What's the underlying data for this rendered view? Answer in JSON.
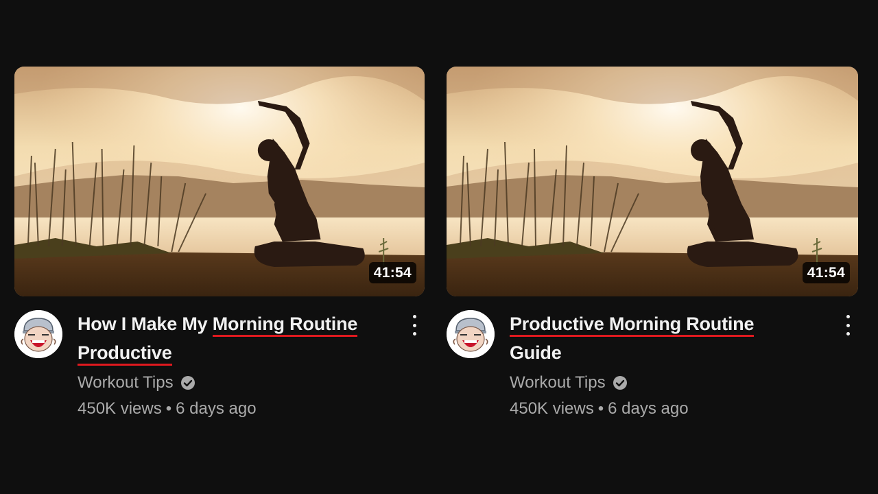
{
  "videos": [
    {
      "title_plain": "How I Make My ",
      "title_highlight_1": "Morning Routine",
      "title_highlight_2": "Productive",
      "title_after": "",
      "duration": "41:54",
      "channel": "Workout Tips",
      "views": "450K views",
      "separator": "•",
      "age": "6 days ago",
      "verified_icon": "check-circle-icon",
      "menu_icon": "more-vertical-icon"
    },
    {
      "title_plain": "",
      "title_highlight_1": "Productive Morning Routine",
      "title_highlight_2": "",
      "title_after": "Guide",
      "duration": "41:54",
      "channel": "Workout Tips",
      "views": "450K views",
      "separator": "•",
      "age": "6 days ago",
      "verified_icon": "check-circle-icon",
      "menu_icon": "more-vertical-icon"
    }
  ],
  "colors": {
    "background": "#0f0f0f",
    "highlight_underline": "#e0191f",
    "secondary_text": "#aaaaaa"
  }
}
